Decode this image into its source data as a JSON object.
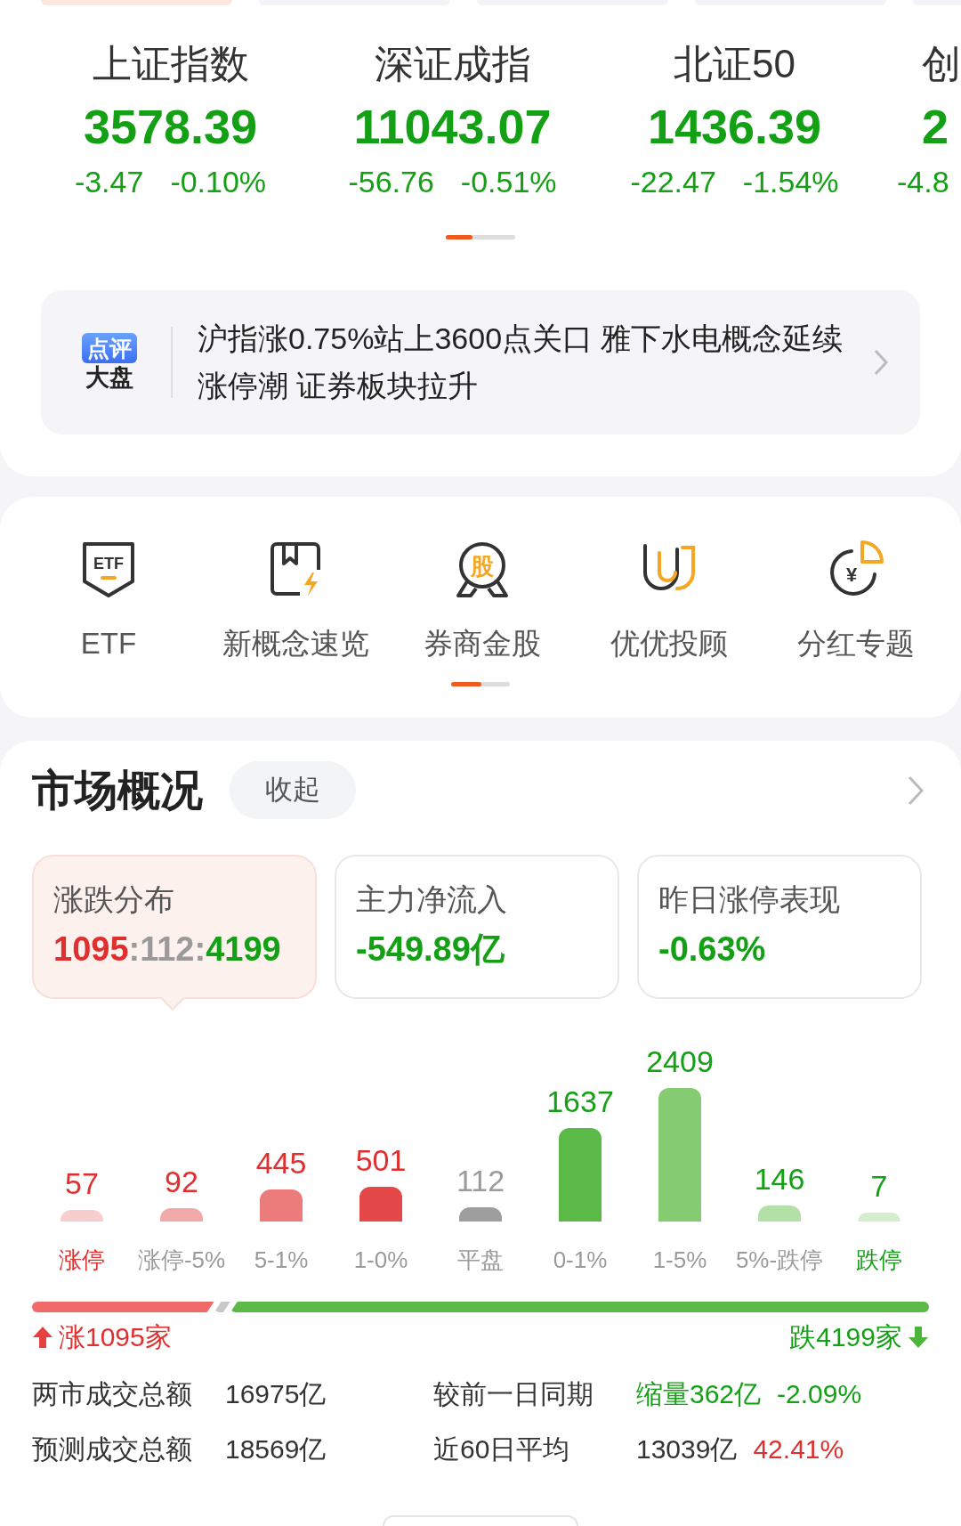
{
  "top_tabs": [
    {
      "selected": true
    },
    {
      "selected": false
    },
    {
      "selected": false
    },
    {
      "selected": false
    },
    {
      "selected": false
    }
  ],
  "indices": [
    {
      "name": "上证指数",
      "value": "3578.39",
      "change": "-3.47",
      "percent": "-0.10%"
    },
    {
      "name": "深证成指",
      "value": "11043.07",
      "change": "-56.76",
      "percent": "-0.51%"
    },
    {
      "name": "北证50",
      "value": "1436.39",
      "change": "-22.47",
      "percent": "-1.54%"
    },
    {
      "name": "创",
      "value": "2",
      "change": "-4.8"
    }
  ],
  "commentary": {
    "logo_top": "点评",
    "logo_bottom": "大盘",
    "text": "沪指涨0.75%站上3600点关口 雅下水电概念延续涨停潮 证券板块拉升"
  },
  "shortcuts": [
    {
      "kind": "etf",
      "label": "ETF",
      "icon_text": "ETF"
    },
    {
      "kind": "concept",
      "label": "新概念速览"
    },
    {
      "kind": "badge",
      "label": "券商金股",
      "icon_text": "股"
    },
    {
      "kind": "advisor",
      "label": "优优投顾"
    },
    {
      "kind": "dividend",
      "label": "分红专题",
      "icon_text": "¥"
    }
  ],
  "market": {
    "title": "市场概况",
    "collapse_button": "收起",
    "stats": [
      {
        "title": "涨跌分布",
        "selected": true,
        "parts": [
          {
            "text": "1095",
            "kind": "up"
          },
          {
            "text": ":",
            "kind": "flat"
          },
          {
            "text": "112",
            "kind": "flat"
          },
          {
            "text": ":",
            "kind": "flat"
          },
          {
            "text": "4199",
            "kind": "down"
          }
        ]
      },
      {
        "title": "主力净流入",
        "selected": false,
        "parts": [
          {
            "text": "-549.89亿",
            "kind": "down"
          }
        ]
      },
      {
        "title": "昨日涨停表现",
        "selected": false,
        "parts": [
          {
            "text": "-0.63%",
            "kind": "down"
          }
        ]
      }
    ],
    "distribution": [
      {
        "label": "涨停",
        "count": "57",
        "kind": "up",
        "color": "#f8cdcd",
        "emphasized": true
      },
      {
        "label": "涨停-5%",
        "count": "92",
        "kind": "up",
        "color": "#f2a9a9",
        "emphasized": false
      },
      {
        "label": "5-1%",
        "count": "445",
        "kind": "up",
        "color": "#ec7b7b",
        "emphasized": false
      },
      {
        "label": "1-0%",
        "count": "501",
        "kind": "up",
        "color": "#e54848",
        "emphasized": false
      },
      {
        "label": "平盘",
        "count": "112",
        "kind": "flat",
        "color": "#9e9e9e",
        "emphasized": false
      },
      {
        "label": "0-1%",
        "count": "1637",
        "kind": "down",
        "color": "#5bb947",
        "emphasized": false
      },
      {
        "label": "1-5%",
        "count": "2409",
        "kind": "down",
        "color": "#84cb71",
        "emphasized": false
      },
      {
        "label": "5%-跌停",
        "count": "146",
        "kind": "down",
        "color": "#b3e0a6",
        "emphasized": false
      },
      {
        "label": "跌停",
        "count": "7",
        "kind": "down",
        "color": "#d6eed0",
        "emphasized": true
      }
    ],
    "ratio": [
      {
        "kind": "up",
        "level": 0.203
      },
      {
        "kind": "flat",
        "level": 0.018
      },
      {
        "kind": "down",
        "level": 0.779
      }
    ],
    "up_count": "涨1095家",
    "down_count": "跌4199家",
    "turnover": [
      {
        "label": "两市成交总额",
        "value": "16975亿",
        "compare_label": "较前一日同期",
        "compare_parts": [
          {
            "text": "缩量362亿",
            "kind": "down"
          },
          {
            "text": "-2.09%",
            "kind": "down"
          }
        ]
      },
      {
        "label": "预测成交总额",
        "value": "18569亿",
        "compare_label": "近60日平均",
        "compare_parts": [
          {
            "text": "13039亿",
            "kind": "flat"
          },
          {
            "text": "42.41%",
            "kind": "up"
          }
        ]
      }
    ]
  }
}
